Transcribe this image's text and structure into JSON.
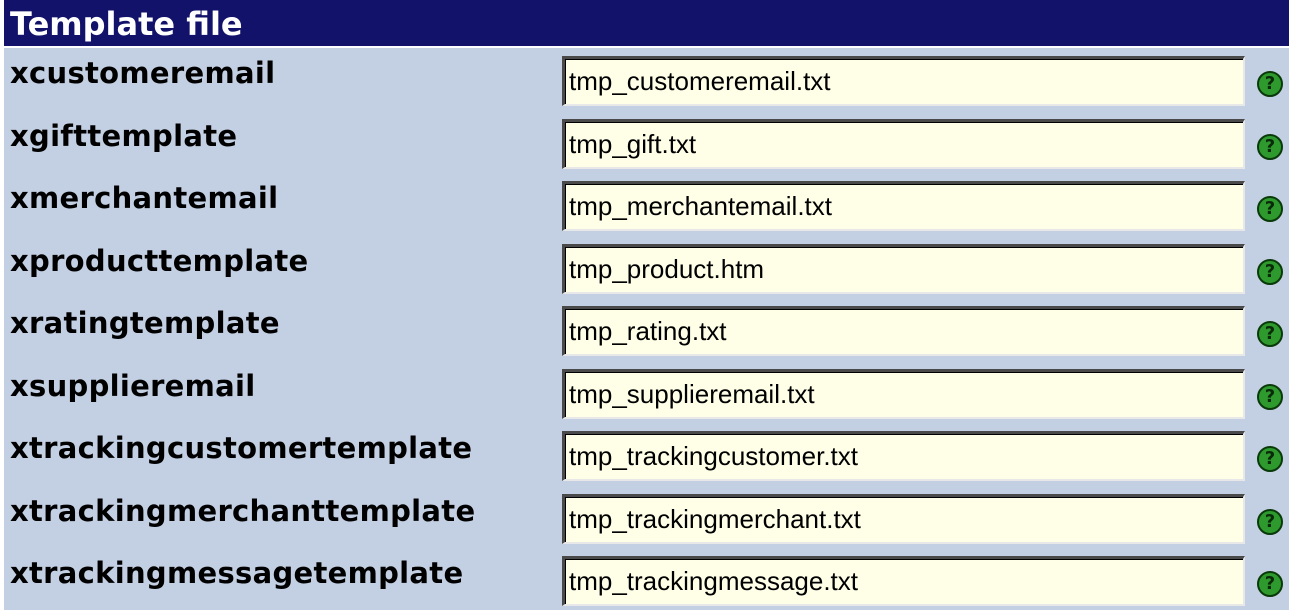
{
  "section": {
    "title": "Template file"
  },
  "help_glyph": "?",
  "colors": {
    "header_bg": "#12126a",
    "panel_bg": "#c3cfe2",
    "field_bg": "#ffffe8",
    "help_icon": "#2e9a2e"
  },
  "rows": [
    {
      "label": "xcustomeremail",
      "value": "tmp_customeremail.txt"
    },
    {
      "label": "xgifttemplate",
      "value": "tmp_gift.txt"
    },
    {
      "label": "xmerchantemail",
      "value": "tmp_merchantemail.txt"
    },
    {
      "label": "xproducttemplate",
      "value": "tmp_product.htm"
    },
    {
      "label": "xratingtemplate",
      "value": "tmp_rating.txt"
    },
    {
      "label": "xsupplieremail",
      "value": "tmp_supplieremail.txt"
    },
    {
      "label": "xtrackingcustomertemplate",
      "value": "tmp_trackingcustomer.txt"
    },
    {
      "label": "xtrackingmerchanttemplate",
      "value": "tmp_trackingmerchant.txt"
    },
    {
      "label": "xtrackingmessagetemplate",
      "value": "tmp_trackingmessage.txt"
    }
  ]
}
